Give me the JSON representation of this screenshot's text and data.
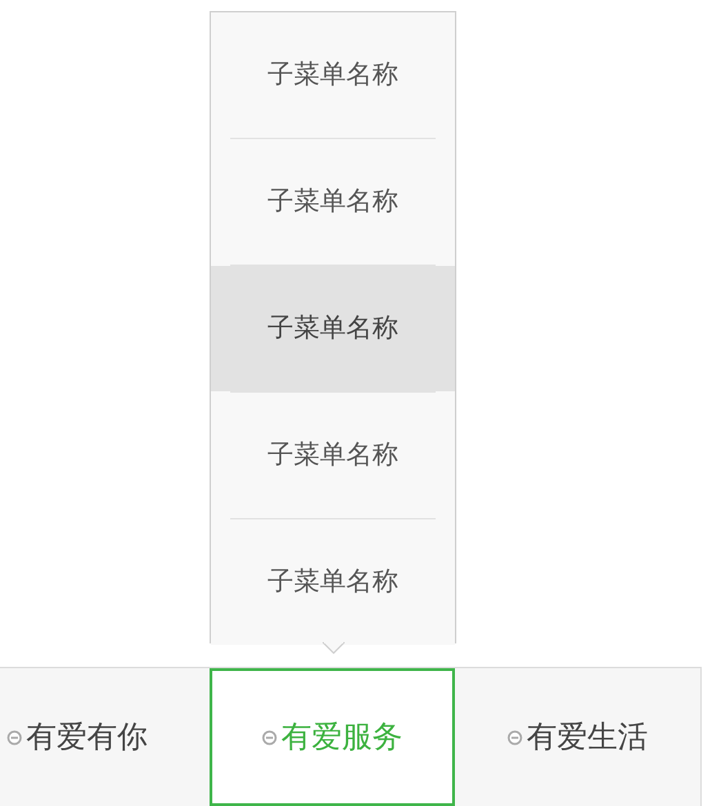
{
  "submenu": {
    "items": [
      {
        "label": "子菜单名称",
        "selected": false
      },
      {
        "label": "子菜单名称",
        "selected": false
      },
      {
        "label": "子菜单名称",
        "selected": true
      },
      {
        "label": "子菜单名称",
        "selected": false
      },
      {
        "label": "子菜单名称",
        "selected": false
      }
    ]
  },
  "tabs": [
    {
      "label": "有爱有你",
      "selected": false
    },
    {
      "label": "有爱服务",
      "selected": true
    },
    {
      "label": "有爱生活",
      "selected": false
    }
  ]
}
